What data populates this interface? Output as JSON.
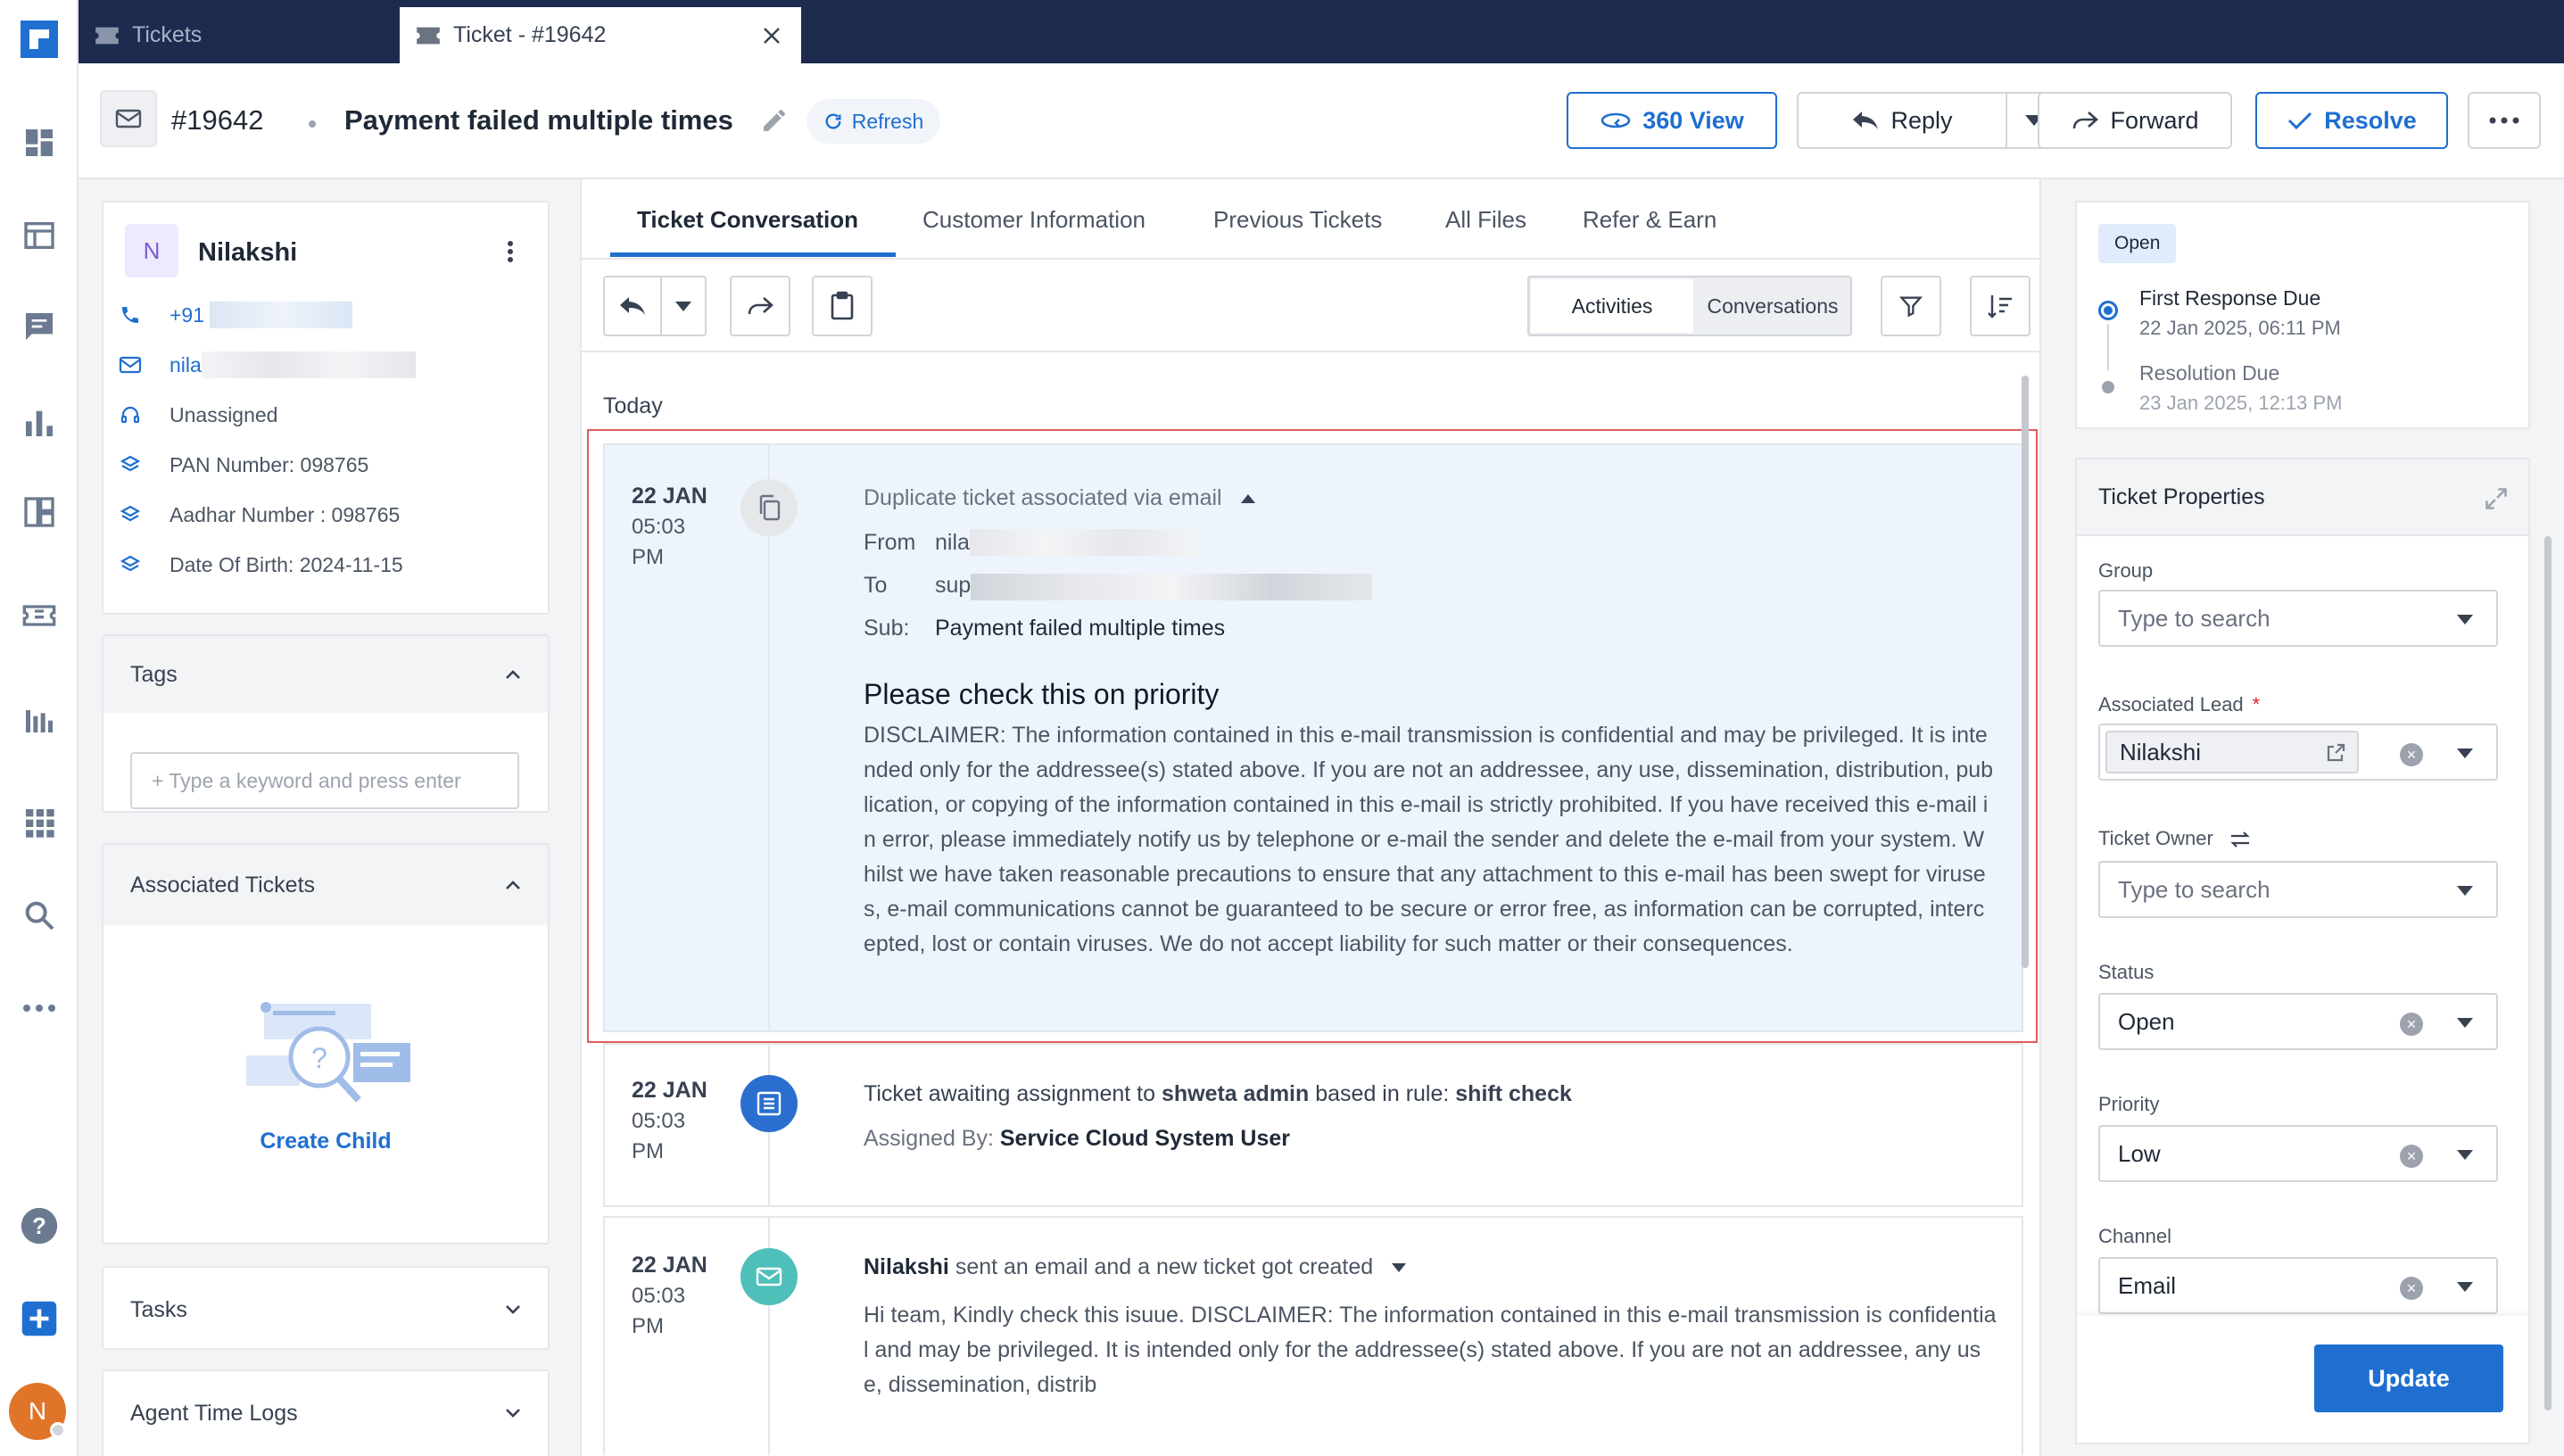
{
  "browser_tabs": [
    {
      "label": "Tickets",
      "icon": "ticket-icon"
    },
    {
      "label": "Ticket - #19642",
      "icon": "ticket-icon"
    }
  ],
  "header": {
    "ticket_id": "#19642",
    "subject": "Payment failed multiple times",
    "refresh_label": "Refresh",
    "view360_label": "360 View",
    "reply_label": "Reply",
    "forward_label": "Forward",
    "resolve_label": "Resolve"
  },
  "customer": {
    "initial": "N",
    "name": "Nilakshi",
    "phone": "+91",
    "email": "nila",
    "assignment": "Unassigned",
    "pan": "PAN Number: 098765",
    "aadhar": "Aadhar Number : 098765",
    "dob": "Date Of Birth: 2024-11-15"
  },
  "tags": {
    "title": "Tags",
    "placeholder": "+ Type a keyword and press enter"
  },
  "associated": {
    "title": "Associated Tickets",
    "create_child": "Create Child"
  },
  "tasks_title": "Tasks",
  "time_logs_title": "Agent Time Logs",
  "content_tabs": [
    "Ticket Conversation",
    "Customer Information",
    "Previous Tickets",
    "All Files",
    "Refer & Earn"
  ],
  "toolbar": {
    "activities": "Activities",
    "conversations": "Conversations"
  },
  "timeline": {
    "group_label": "Today",
    "entries": [
      {
        "day": "22 JAN",
        "time": "05:03",
        "ampm": "PM",
        "title": "Duplicate ticket associated via email",
        "from_label": "From",
        "from_value": "nila",
        "to_label": "To",
        "to_value": "sup",
        "sub_label": "Sub:",
        "sub_value": "Payment failed multiple times",
        "heading": "Please check this on priority",
        "body": "DISCLAIMER: The information contained in this e-mail transmission is confidential and may be privileged. It is intended only for the addressee(s) stated above. If you are not an addressee, any use, dissemination, distribution, publication, or copying of the information contained in this e-mail is strictly prohibited. If you have received this e-mail in error, please immediately notify us by telephone or e-mail the sender and delete the e-mail from your system. Whilst we have taken reasonable precautions to ensure that any attachment to this e-mail has been swept for viruses, e-mail communications cannot be guaranteed to be secure or error free, as information can be corrupted, intercepted, lost or contain viruses. We do not accept liability for such matter or their consequences."
      },
      {
        "day": "22 JAN",
        "time": "05:03",
        "ampm": "PM",
        "text_a": "Ticket awaiting assignment to ",
        "agent": "shweta admin",
        "text_b": " based in rule: ",
        "rule": "shift check",
        "assigned_by_label": "Assigned By: ",
        "assigned_by": "Service Cloud System User"
      },
      {
        "day": "22 JAN",
        "time": "05:03",
        "ampm": "PM",
        "sender": "Nilakshi",
        "action": " sent an email and a new ticket got created",
        "body": "Hi team, Kindly check this isuue. DISCLAIMER: The information contained in this e-mail transmission is confidential and may be privileged. It is intended only for the addressee(s) stated above. If you are not an addressee, any use, dissemination, distrib"
      }
    ]
  },
  "sla": {
    "status_badge": "Open",
    "first_response_label": "First Response Due",
    "first_response_date": "22 Jan 2025, 06:11 PM",
    "resolution_label": "Resolution Due",
    "resolution_date": "23 Jan 2025, 12:13 PM"
  },
  "properties": {
    "title": "Ticket Properties",
    "group_label": "Group",
    "group_placeholder": "Type to search",
    "lead_label": "Associated Lead",
    "lead_value": "Nilakshi",
    "owner_label": "Ticket Owner",
    "owner_placeholder": "Type to search",
    "status_label": "Status",
    "status_value": "Open",
    "priority_label": "Priority",
    "priority_value": "Low",
    "channel_label": "Channel",
    "channel_value": "Email",
    "update_label": "Update"
  },
  "user_avatar_initial": "N",
  "colors": {
    "brand_dark": "#1d2b4f",
    "accent_blue": "#1f6fd1",
    "highlight_red": "#e25c5c",
    "entry_bg": "#eef4fc"
  }
}
